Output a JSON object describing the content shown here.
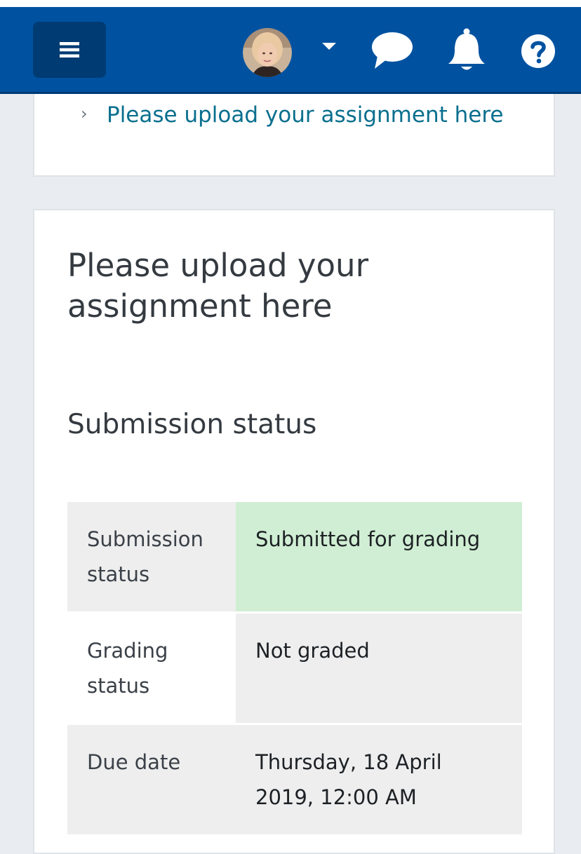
{
  "navbar": {
    "menu_icon": "hamburger-icon",
    "avatar": "user-avatar",
    "dropdown_icon": "caret-down-icon",
    "messages_icon": "chat-bubble-icon",
    "notifications_icon": "bell-icon",
    "help_icon": "question-circle-icon"
  },
  "breadcrumb": {
    "chevron": "›",
    "link": "Please upload your assignment here"
  },
  "page": {
    "title": "Please upload your assignment here",
    "section_title": "Submission status"
  },
  "status_table": {
    "rows": [
      {
        "label": "Submission status",
        "value": "Submitted for grading"
      },
      {
        "label": "Grading status",
        "value": "Not graded"
      },
      {
        "label": "Due date",
        "value": "Thursday, 18 April 2019, 12:00 AM"
      }
    ]
  },
  "colors": {
    "navbar": "#0052a0",
    "menu_button": "#003b73",
    "link": "#0a6f8e",
    "success_cell": "#d0eed3",
    "neutral_cell": "#eeeeee",
    "page_background": "#e9edf1"
  }
}
